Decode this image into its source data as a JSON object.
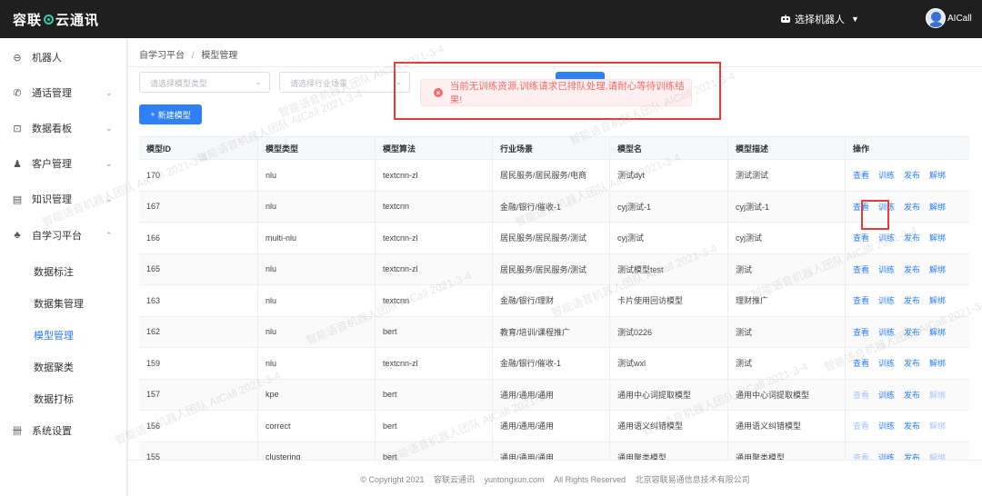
{
  "app": {
    "logo_left": "容联",
    "logo_right": "云通讯",
    "robot_select": "选择机器人",
    "user_name": "AICall"
  },
  "sidebar": {
    "items": [
      {
        "label": "机器人",
        "icon": "robot-icon"
      },
      {
        "label": "通话管理",
        "icon": "phone-icon"
      },
      {
        "label": "数据看板",
        "icon": "chart-icon"
      },
      {
        "label": "客户管理",
        "icon": "users-icon"
      },
      {
        "label": "知识管理",
        "icon": "book-icon"
      },
      {
        "label": "自学习平台",
        "icon": "learning-icon"
      },
      {
        "label": "系统设置",
        "icon": "settings-icon"
      }
    ],
    "sub_items": [
      {
        "label": "数据标注"
      },
      {
        "label": "数据集管理"
      },
      {
        "label": "模型管理"
      },
      {
        "label": "数据聚类"
      },
      {
        "label": "数据打标"
      }
    ]
  },
  "breadcrumb": {
    "root": "自学习平台",
    "sep": "/",
    "current": "模型管理"
  },
  "filters": {
    "model_type_placeholder": "请选择模型类型",
    "industry_placeholder": "请选择行业场景"
  },
  "new_button": {
    "label": "新建模型"
  },
  "toast": {
    "message": "当前无训练资源,训练请求已排队处理,请耐心等待训练结果!",
    "color": "#f56c6c"
  },
  "table": {
    "headers": [
      "模型ID",
      "模型类型",
      "模型算法",
      "行业场景",
      "模型名",
      "模型描述",
      "操作"
    ],
    "actions": [
      "查看",
      "训练",
      "发布",
      "解绑"
    ],
    "rows": [
      [
        "170",
        "nlu",
        "textcnn-zl",
        "居民服务/居民服务/电商",
        "测试dyt",
        "测试测试"
      ],
      [
        "167",
        "nlu",
        "textcnn",
        "金融/银行/催收-1",
        "cyj测试-1",
        "cyj测试-1"
      ],
      [
        "166",
        "multi-nlu",
        "textcnn-zl",
        "居民服务/居民服务/测试",
        "cyj测试",
        "cyj测试"
      ],
      [
        "165",
        "nlu",
        "textcnn-zl",
        "居民服务/居民服务/测试",
        "测试模型test",
        "测试"
      ],
      [
        "163",
        "nlu",
        "textcnn",
        "金融/银行/理财",
        "卡片使用回访模型",
        "理财推广"
      ],
      [
        "162",
        "nlu",
        "bert",
        "教育/培训/课程推广",
        "测试0226",
        "测试"
      ],
      [
        "159",
        "nlu",
        "textcnn-zl",
        "金融/银行/催收-1",
        "测试wxl",
        "测试"
      ],
      [
        "157",
        "kpe",
        "bert",
        "通用/通用/通用",
        "通用中心词提取模型",
        "通用中心词提取模型"
      ],
      [
        "156",
        "correct",
        "bert",
        "通用/通用/通用",
        "通用语义纠错模型",
        "通用语义纠错模型"
      ],
      [
        "155",
        "clustering",
        "bert",
        "通用/通用/通用",
        "通用聚类模型",
        "通用聚类模型"
      ]
    ]
  },
  "footer": {
    "copyright": "© Copyright 2021",
    "brand": "容联云通讯",
    "domain": "yuntongxun.com",
    "rights": "All Rights Reserved",
    "company": "北京容联易通信息技术有限公司"
  },
  "watermark": "智能语音机器人团队 AICall 2021-3-4",
  "colors": {
    "primary": "#2f7ff6",
    "topbar": "#1f1f1f",
    "highlight_border": "#e23c3c"
  }
}
